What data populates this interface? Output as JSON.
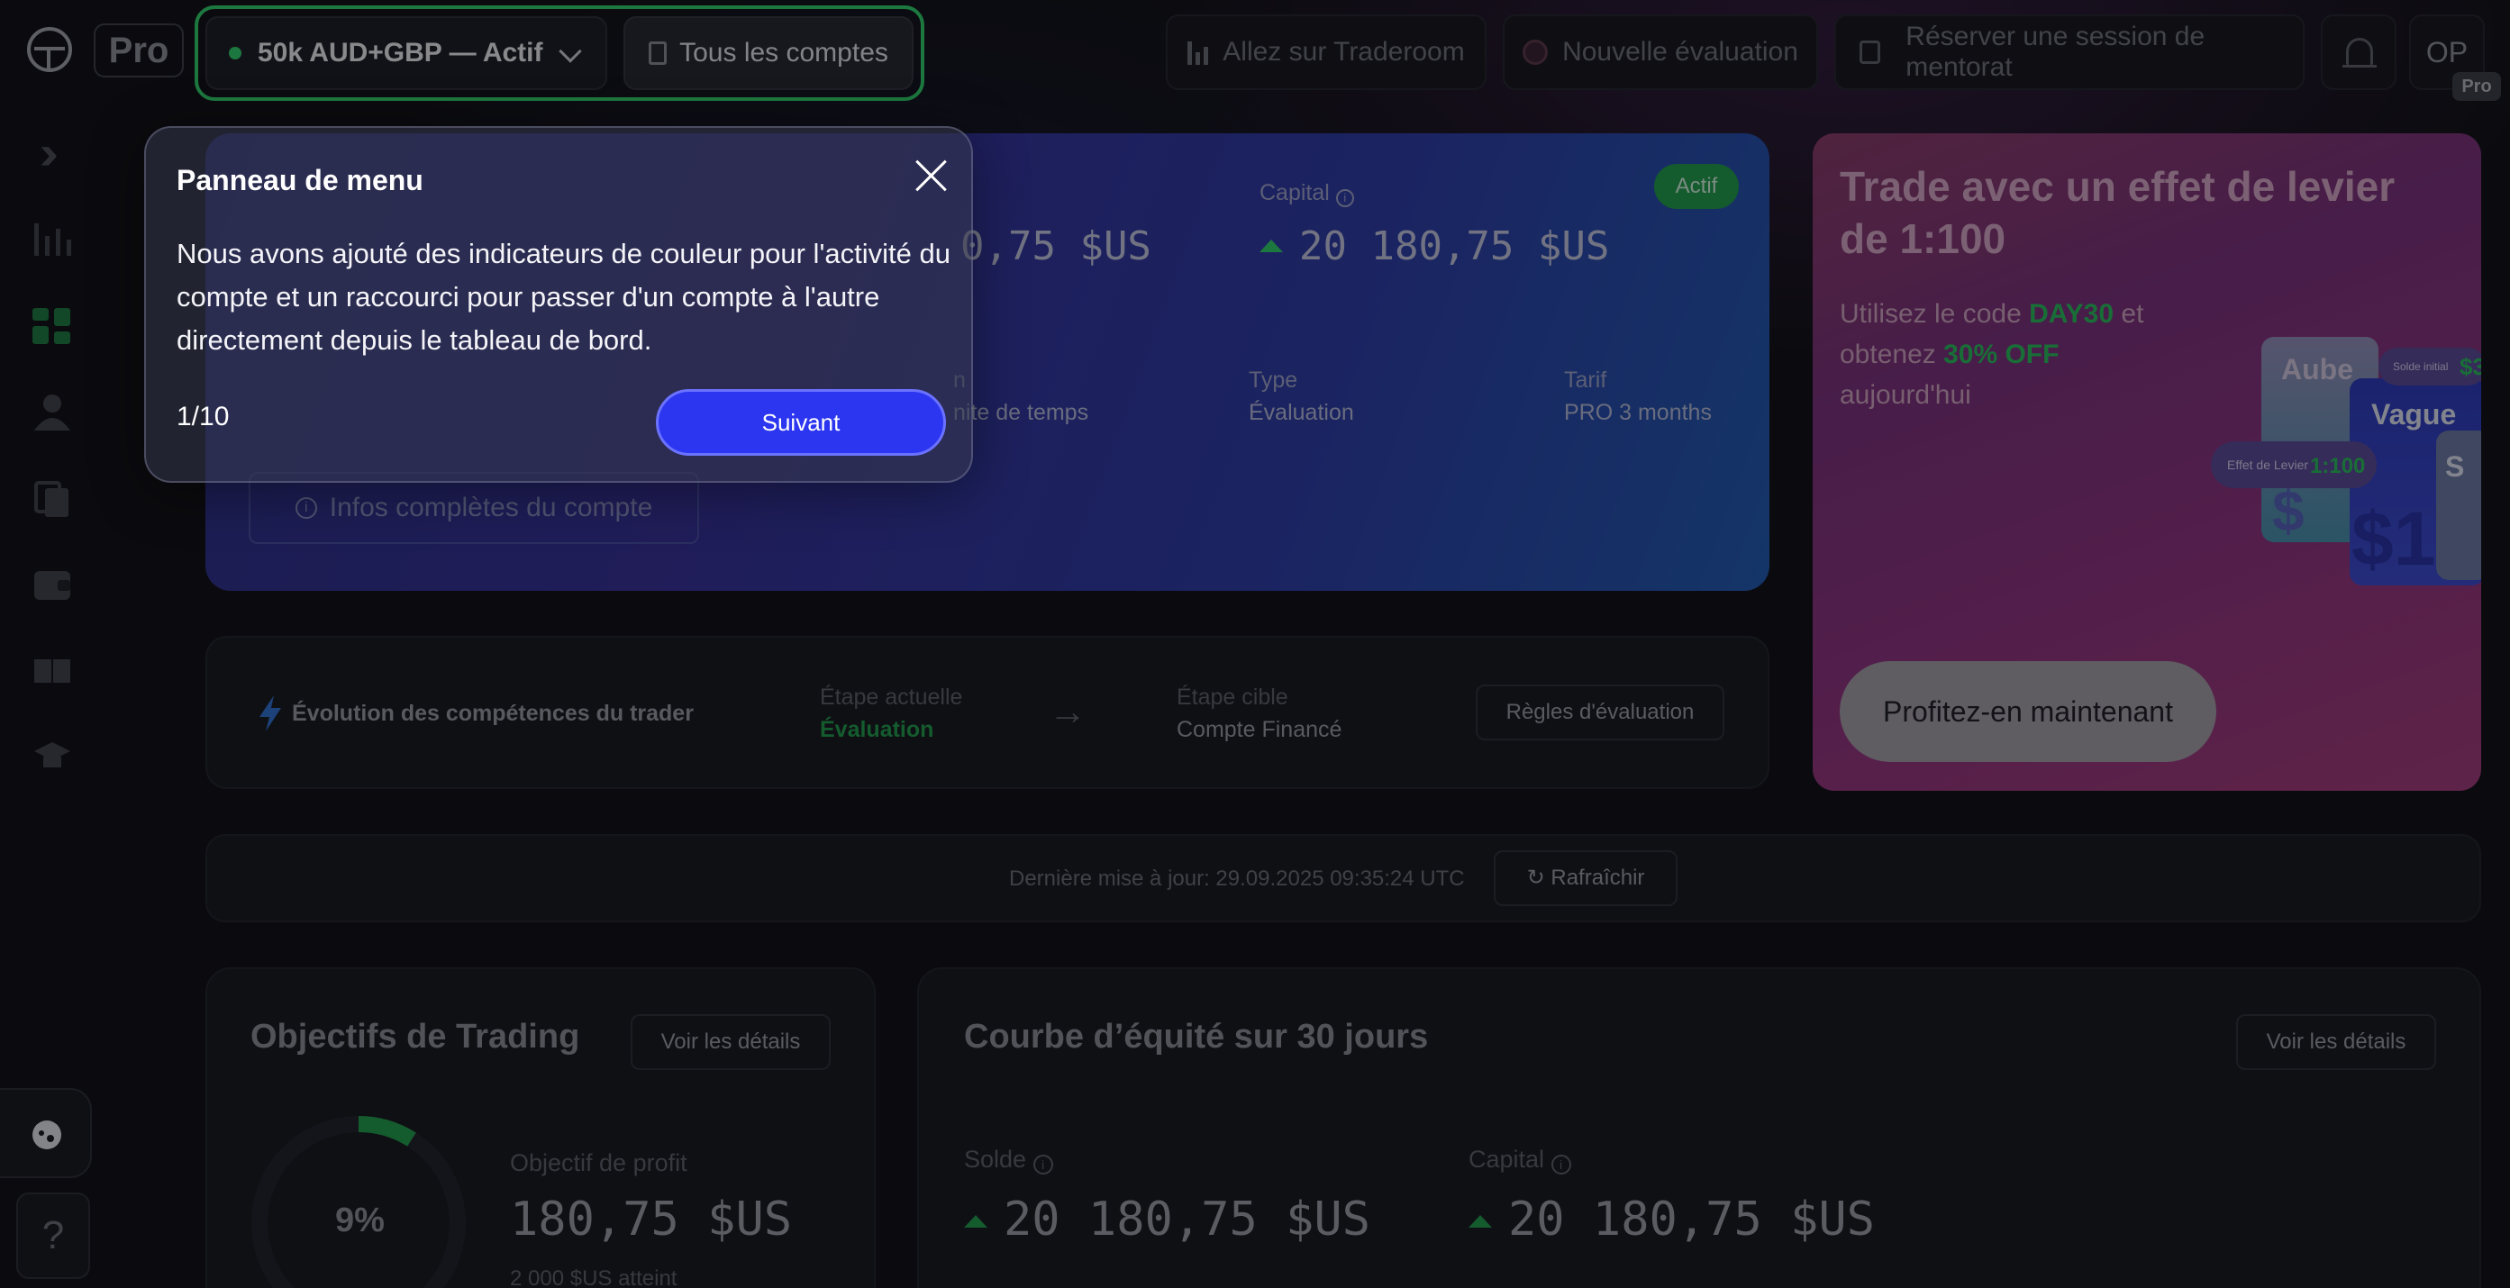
{
  "topbar": {
    "pro_tag": "Pro",
    "account_selector": "50k AUD+GBP — Actif",
    "all_accounts": "Tous les comptes",
    "traderoom": "Allez sur Traderoom",
    "new_evaluation": "Nouvelle évaluation",
    "mentoring": "Réserver une session de mentorat",
    "avatar_initials": "OP",
    "avatar_badge": "Pro"
  },
  "account_card": {
    "status": "Actif",
    "balance_partial": "0,75 $US",
    "capital_label": "Capital",
    "capital_value": "20 180,75 $US",
    "col1_label_partial": "n",
    "col1_value_partial": "nite de temps",
    "type_label": "Type",
    "type_value": "Évaluation",
    "tarif_label": "Tarif",
    "tarif_value": "PRO 3 months",
    "info_button": "Infos complètes du compte"
  },
  "promo": {
    "title": "Trade avec un effet de levier de 1:100",
    "sub_1": "Utilisez le code ",
    "code": "DAY30",
    "sub_2": " et obtenez ",
    "discount": "30% OFF",
    "sub_3": " aujourd'hui",
    "cta": "Profitez-en maintenant",
    "card_aube": "Aube",
    "card_vague": "Vague",
    "card_s": "S",
    "chip_solde": "Solde initial",
    "chip_solde_val": "$3",
    "chip_levier": "Effet de Levier",
    "chip_levier_val": "1:100",
    "card_amount": "$1",
    "card_amount_2": "$"
  },
  "skills": {
    "title": "Évolution des compétences du trader",
    "current_label": "Étape actuelle",
    "current_value": "Évaluation",
    "arrow": "→",
    "target_label": "Étape cible",
    "target_value": "Compte Financé",
    "rules_button": "Règles d'évaluation"
  },
  "update_bar": {
    "text": "Dernière mise à jour: 29.09.2025 09:35:24 UTC",
    "refresh": "Rafraîchir"
  },
  "objectives": {
    "title": "Objectifs de Trading",
    "details": "Voir les détails",
    "progress_percent": 9,
    "progress_label": "9%",
    "profit_label": "Objectif de profit",
    "profit_value": "180,75 $US",
    "reached": "2 000 $US atteint"
  },
  "equity": {
    "title": "Courbe d’équité sur 30 jours",
    "details": "Voir les détails",
    "balance_label": "Solde",
    "balance_value": "20 180,75 $US",
    "capital_label": "Capital",
    "capital_value": "20 180,75 $US"
  },
  "help": {
    "label": "?"
  },
  "popup": {
    "title": "Panneau de menu",
    "body": "Nous avons ajouté des indicateurs de couleur pour l'activité du compte et un raccourci pour passer d'un compte à l'autre directement depuis le tableau de bord.",
    "step": "1/10",
    "next": "Suivant"
  }
}
